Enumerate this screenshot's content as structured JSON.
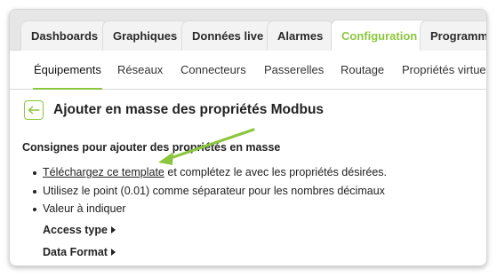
{
  "tabs": [
    {
      "label": "Dashboards"
    },
    {
      "label": "Graphiques"
    },
    {
      "label": "Données live"
    },
    {
      "label": "Alarmes"
    },
    {
      "label": "Configuration"
    },
    {
      "label": "Programma"
    }
  ],
  "subnav": [
    {
      "label": "Équipements"
    },
    {
      "label": "Réseaux"
    },
    {
      "label": "Connecteurs"
    },
    {
      "label": "Passerelles"
    },
    {
      "label": "Routage"
    },
    {
      "label": "Propriétés virtuel"
    }
  ],
  "page": {
    "title": "Ajouter en masse des propriétés Modbus",
    "section_title": "Consignes pour ajouter des propriétés en masse",
    "instructions": {
      "link_text": "Téléchargez ce template",
      "link_suffix": " et complétez le avec les propriétés désirées.",
      "decimal_note": "Utilisez le point (0.01) comme séparateur pour les nombres décimaux",
      "value_note": "Valeur à indiquer"
    },
    "access_type": "Access type",
    "data_format": "Data Format"
  },
  "colors": {
    "accent": "#8cc63e",
    "annotation_arrow": "#8cc63e"
  },
  "icons": {
    "back": "arrow-left-icon",
    "caret": "caret-right-icon"
  }
}
